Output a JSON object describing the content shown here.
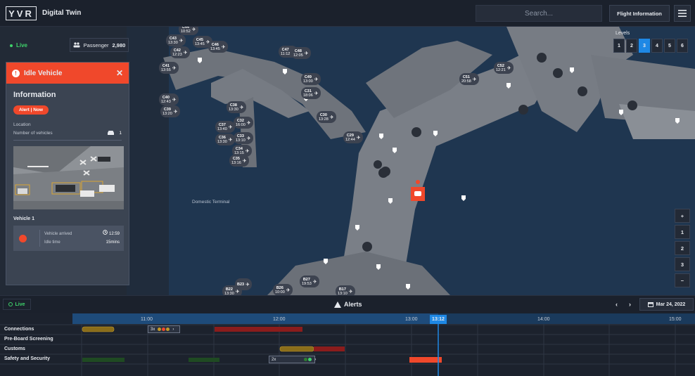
{
  "header": {
    "logo": "YVR",
    "title": "Digital Twin",
    "search_placeholder": "Search...",
    "flight_info": "Flight Information"
  },
  "status": {
    "live": "Live"
  },
  "passenger": {
    "label": "Passenger",
    "count": "2,980"
  },
  "alert_panel": {
    "title": "Idle Vehicle",
    "section": "Information",
    "badge": "Alert | Now",
    "location_label": "Location",
    "vehicles_label": "Number of vehicles",
    "vehicles_count": "1",
    "vehicle_title": "Vehicle 1",
    "arrived_label": "Vehicle arrived",
    "arrived_time": "12:59",
    "idle_label": "Idle time",
    "idle_value": "15mins"
  },
  "levels": {
    "label": "Levels",
    "items": [
      "1",
      "2",
      "3",
      "4",
      "5",
      "6"
    ],
    "active": "3"
  },
  "zoom": {
    "plus": "+",
    "items": [
      "1",
      "2",
      "3"
    ],
    "minus": "−"
  },
  "map": {
    "label": "Domestic Terminal",
    "gates": [
      {
        "id": "C44",
        "time": "10:52"
      },
      {
        "id": "C43",
        "time": "13:30"
      },
      {
        "id": "C45",
        "time": "13:45"
      },
      {
        "id": "C42",
        "time": "12:23"
      },
      {
        "id": "C46",
        "time": "13:45"
      },
      {
        "id": "C47",
        "time": "11:12"
      },
      {
        "id": "C48",
        "time": "12:05"
      },
      {
        "id": "C41",
        "time": "13:55"
      },
      {
        "id": "C49",
        "time": "13:00"
      },
      {
        "id": "C31",
        "time": "18:06"
      },
      {
        "id": "C51",
        "time": "20:58"
      },
      {
        "id": "C52",
        "time": "12:21"
      },
      {
        "id": "C40",
        "time": "12:43"
      },
      {
        "id": "C38",
        "time": "13:30"
      },
      {
        "id": "C39",
        "time": "13:20"
      },
      {
        "id": "C30",
        "time": "13:28"
      },
      {
        "id": "C32",
        "time": "16:00"
      },
      {
        "id": "C37",
        "time": "13:40"
      },
      {
        "id": "C29",
        "time": "12:44"
      },
      {
        "id": "C33",
        "time": "13:10"
      },
      {
        "id": "C36",
        "time": "13:30"
      },
      {
        "id": "C34",
        "time": "13:15"
      },
      {
        "id": "C35",
        "time": "13:16"
      },
      {
        "id": "B23",
        "time": ""
      },
      {
        "id": "B27",
        "time": "19:53"
      },
      {
        "id": "B22",
        "time": "13:30"
      },
      {
        "id": "B26",
        "time": "10:00"
      },
      {
        "id": "B17",
        "time": "13:10"
      }
    ]
  },
  "bottom": {
    "live": "Live",
    "alerts": "Alerts",
    "prev": "‹",
    "next": "›",
    "date": "Mar 24, 2022",
    "now_time": "13:12",
    "ticks": [
      "11:00",
      "12:00",
      "13:00",
      "14:00",
      "15:00"
    ],
    "categories": [
      "Connections",
      "Pre-Board Screening",
      "Customs",
      "Safety and Security"
    ],
    "badge1": "3x",
    "badge2": "2x"
  },
  "colors": {
    "accent": "#1e88e5",
    "alert": "#f0482b",
    "live": "#3fd36b",
    "warning_bar": "#8a6d1a",
    "danger_bar": "#8b1c1c",
    "safe_bar": "#1f4a22"
  }
}
